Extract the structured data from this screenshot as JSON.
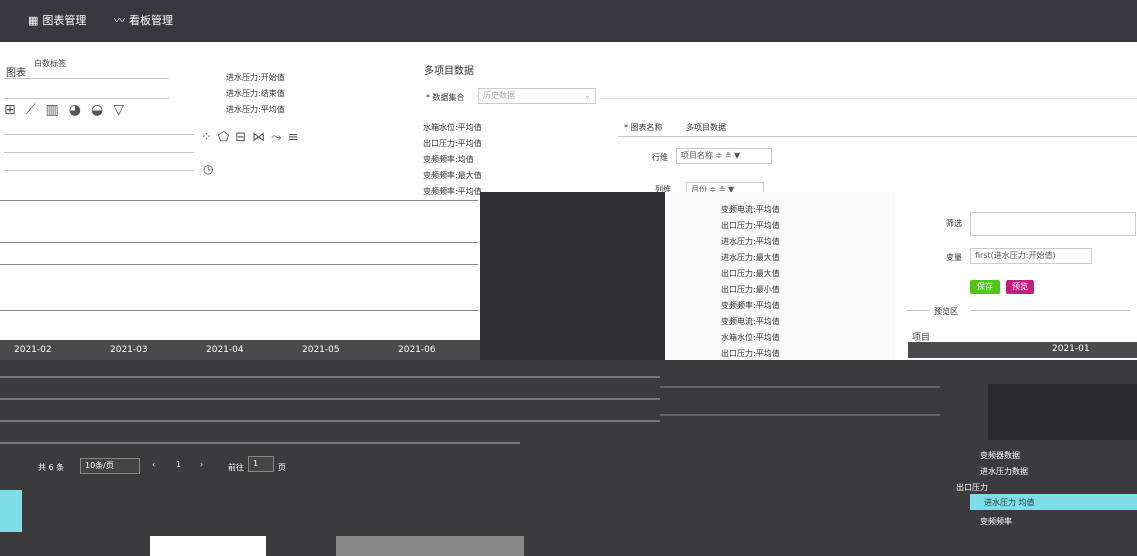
{
  "nav": {
    "tabs": [
      {
        "label": "图表管理",
        "icon": "grid-icon",
        "active": true
      },
      {
        "label": "看板管理",
        "icon": "wave-icon",
        "active": false
      }
    ]
  },
  "left": {
    "chart_label": "图表",
    "selected": "白数标签",
    "chart_type_icons": [
      "table-icon",
      "line-chart-icon",
      "bar-chart-icon",
      "pie-chart-icon",
      "gauge-icon",
      "funnel-icon"
    ],
    "extra_icons": [
      "scatter-icon",
      "radar-icon",
      "bar-h-icon",
      "bowtie-icon",
      "tree-icon",
      "list-icon",
      "clock-icon"
    ]
  },
  "fields_col1": [
    "进水压力:开始值",
    "进水压力:结束值",
    "进水压力:平均值"
  ],
  "fields_col2": [
    "水箱水位:平均值",
    "出口压力:平均值",
    "变频频率:均值",
    "变频频率:最大值",
    "变频频率:平均值"
  ],
  "fields_col3": [
    "变频电流:平均值",
    "出口压力:平均值",
    "进水压力:平均值",
    "进水压力:最大值",
    "出口压力:最大值",
    "出口压力:最小值",
    "变频频率:平均值",
    "变频电流:平均值",
    "水箱水位:平均值",
    "出口压力:平均值",
    "出口压力:最大值"
  ],
  "form": {
    "section_title": "多项目数据",
    "dataset_label": "* 数据集合",
    "dataset_placeholder": "历史数据",
    "chart_name_label": "* 图表名称",
    "chart_name_value": "多项目数据",
    "row_label": "行维",
    "row_chip": "项目名称",
    "col_label": "列维",
    "col_chip": "月份",
    "filter_label": "筛选",
    "variable_label": "变量",
    "variable_value": "first(进水压力:开始值)",
    "save": "保存",
    "preview": "预览",
    "preview_section": "预览区"
  },
  "table": {
    "dates": [
      "2021-02",
      "2021-03",
      "2021-04",
      "2021-05",
      "2021-06"
    ],
    "right_date": "2021-01",
    "right_label": "项目",
    "pager_total": "共 6 条",
    "pager_size": "10条/页",
    "pager_goto": "前往",
    "pager_page": "1",
    "pager_unit": "页"
  },
  "tree": {
    "items": [
      "变频器数据",
      "进水压力数据",
      "出口压力",
      "进水压力 均值",
      "变频频率"
    ]
  },
  "colors": {
    "save": "#52c41a",
    "preview": "#c41d7f",
    "accent": "#2f8ff0",
    "topbar": "#363a40"
  }
}
